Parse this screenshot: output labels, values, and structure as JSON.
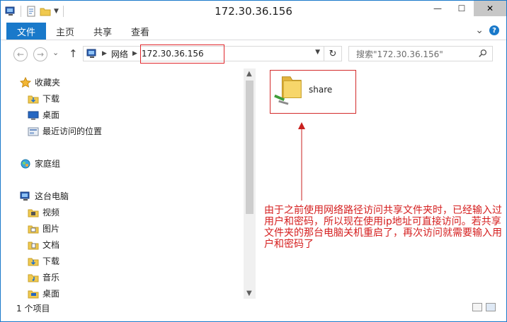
{
  "window": {
    "title": "172.30.36.156",
    "min_label": "—",
    "max_label": "☐",
    "close_label": "✕"
  },
  "ribbon": {
    "file": "文件",
    "tabs": [
      "主页",
      "共享",
      "查看"
    ],
    "collapse": "⌄",
    "help": "?"
  },
  "nav": {
    "back": "←",
    "forward": "→",
    "recent": "⌄",
    "up": "↑",
    "breadcrumb_network": "网络",
    "breadcrumb_host": "172.30.36.156",
    "refresh": "↻",
    "search_placeholder": "搜索\"172.30.36.156\""
  },
  "navpane": {
    "favorites": "收藏夹",
    "fav_items": [
      "下载",
      "桌面",
      "最近访问的位置"
    ],
    "homegroup": "家庭组",
    "thispc": "这台电脑",
    "pc_items": [
      "视频",
      "图片",
      "文档",
      "下载",
      "音乐",
      "桌面"
    ]
  },
  "content": {
    "share_name": "share",
    "annotation": "由于之前使用网络路径访问共享文件夹时，已经输入过用户和密码，所以现在使用ip地址可直接访问。若共享文件夹的那台电脑关机重启了，再次访问就需要输入用户和密码了"
  },
  "status": {
    "count": "1 个项目"
  },
  "colors": {
    "accent": "#1979ca",
    "annotation_red": "#d51e1e"
  }
}
